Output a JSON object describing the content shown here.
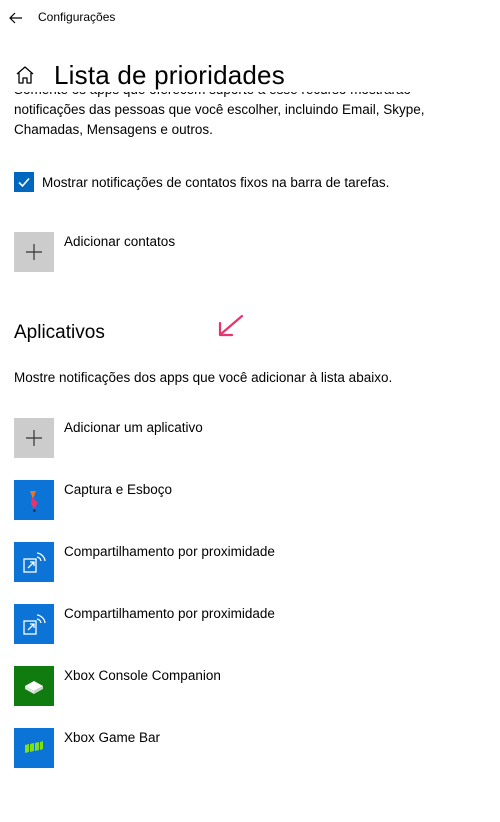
{
  "window": {
    "title": "Configurações"
  },
  "page": {
    "title": "Lista de prioridades",
    "description_partial": "Somente os apps que oferecem suporte a esse recurso mostrarão",
    "description": "notificações das pessoas que você escolher, incluindo Email, Skype, Chamadas, Mensagens e outros."
  },
  "contacts": {
    "checkbox_label": "Mostrar notificações de contatos fixos na barra de tarefas.",
    "checkbox_checked": true,
    "add_label": "Adicionar contatos"
  },
  "apps": {
    "heading": "Aplicativos",
    "description": "Mostre notificações dos apps que você adicionar à lista abaixo.",
    "add_label": "Adicionar um aplicativo",
    "items": [
      {
        "label": "Captura e Esboço",
        "icon": "snip-sketch-icon"
      },
      {
        "label": "Compartilhamento por proximidade",
        "icon": "nearby-share-icon"
      },
      {
        "label": "Compartilhamento por proximidade",
        "icon": "nearby-share-icon"
      },
      {
        "label": "Xbox Console Companion",
        "icon": "xbox-companion-icon"
      },
      {
        "label": "Xbox Game Bar",
        "icon": "xbox-game-bar-icon"
      }
    ]
  },
  "colors": {
    "accent": "#0067c0",
    "tile_blue": "#0b74d6",
    "tile_green": "#107c10",
    "annotation": "#e8336d"
  }
}
